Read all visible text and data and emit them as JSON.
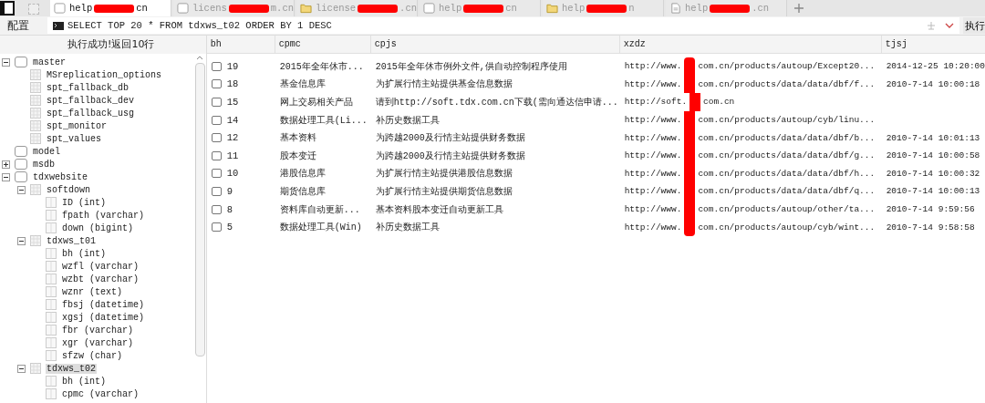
{
  "tabs": [
    {
      "kind": "page",
      "prefix": "help",
      "suffix": "cn",
      "selected": true
    },
    {
      "kind": "page",
      "prefix": "licens",
      "suffix": "m.cn",
      "selected": false
    },
    {
      "kind": "folder",
      "prefix": "license ",
      "suffix": ".cn",
      "selected": false
    },
    {
      "kind": "page",
      "prefix": "help",
      "suffix": "cn",
      "selected": false
    },
    {
      "kind": "folder",
      "prefix": "help",
      "suffix": "n",
      "selected": false
    },
    {
      "kind": "doc",
      "prefix": "help ",
      "suffix": ".cn",
      "selected": false
    }
  ],
  "query_bar": {
    "label": "配置",
    "query": "SELECT TOP 20 * FROM tdxws_t02 ORDER BY 1 DESC",
    "run_button": "执行"
  },
  "status": "执行成功!返回10行",
  "tree": [
    {
      "kind": "database",
      "label": "master",
      "expanded": true,
      "children": [
        {
          "kind": "table",
          "label": "MSreplication_options"
        },
        {
          "kind": "table",
          "label": "spt_fallback_db"
        },
        {
          "kind": "table",
          "label": "spt_fallback_dev"
        },
        {
          "kind": "table",
          "label": "spt_fallback_usg"
        },
        {
          "kind": "table",
          "label": "spt_monitor"
        },
        {
          "kind": "table",
          "label": "spt_values"
        }
      ]
    },
    {
      "kind": "database",
      "label": "model"
    },
    {
      "kind": "database",
      "label": "msdb",
      "expanded": false
    },
    {
      "kind": "database",
      "label": "tdxwebsite",
      "expanded": true,
      "children": [
        {
          "kind": "table",
          "label": "softdown",
          "expanded": true,
          "children": [
            {
              "kind": "column",
              "label": "ID (int)"
            },
            {
              "kind": "column",
              "label": "fpath (varchar)"
            },
            {
              "kind": "column",
              "label": "down (bigint)"
            }
          ]
        },
        {
          "kind": "table",
          "label": "tdxws_t01",
          "expanded": true,
          "children": [
            {
              "kind": "column",
              "label": "bh (int)"
            },
            {
              "kind": "column",
              "label": "wzfl (varchar)"
            },
            {
              "kind": "column",
              "label": "wzbt (varchar)"
            },
            {
              "kind": "column",
              "label": "wznr (text)"
            },
            {
              "kind": "column",
              "label": "fbsj (datetime)"
            },
            {
              "kind": "column",
              "label": "xgsj (datetime)"
            },
            {
              "kind": "column",
              "label": "fbr (varchar)"
            },
            {
              "kind": "column",
              "label": "xgr (varchar)"
            },
            {
              "kind": "column",
              "label": "sfzw (char)"
            }
          ]
        },
        {
          "kind": "table",
          "label": "tdxws_t02",
          "expanded": true,
          "selected": true,
          "children": [
            {
              "kind": "column",
              "label": "bh (int)"
            },
            {
              "kind": "column",
              "label": "cpmc (varchar)"
            }
          ]
        }
      ]
    }
  ],
  "table": {
    "columns": [
      "bh",
      "cpmc",
      "cpjs",
      "xzdz",
      "tjsj"
    ],
    "rows": [
      {
        "checked": false,
        "bh": "19",
        "cpmc": "2015年全年休市...",
        "cpjs": "2015年全年休市例外文件,供自动控制程序使用",
        "xzdz_start": "http://www.",
        "xzdz_end": "com.cn/products/autoup/Except20...",
        "tjsj": "2014-12-25 10:20:00"
      },
      {
        "checked": false,
        "bh": "18",
        "cpmc": "基金信息库",
        "cpjs": "为扩展行情主站提供基金信息数据",
        "xzdz_start": "http://www.",
        "xzdz_end": "com.cn/products/data/data/dbf/f...",
        "tjsj": "2010-7-14 10:00:18"
      },
      {
        "checked": false,
        "bh": "15",
        "cpmc": "网上交易相关产品",
        "cpjs": "请到http://soft.tdx.com.cn下载(需向通达信申请...",
        "xzdz_start": "http://soft.",
        "xzdz_end": "com.cn"
      },
      {
        "checked": false,
        "bh": "14",
        "cpmc": "数据处理工具(Li...",
        "cpjs": "补历史数据工具",
        "xzdz_start": "http://www.",
        "xzdz_end": "com.cn/products/autoup/cyb/linu..."
      },
      {
        "checked": false,
        "bh": "12",
        "cpmc": "基本资料",
        "cpjs": "为跨越2000及行情主站提供财务数据",
        "xzdz_start": "http://www.",
        "xzdz_end": "com.cn/products/data/data/dbf/b...",
        "tjsj": "2010-7-14 10:01:13"
      },
      {
        "checked": false,
        "bh": "11",
        "cpmc": "股本变迁",
        "cpjs": "为跨越2000及行情主站提供财务数据",
        "xzdz_start": "http://www.",
        "xzdz_end": "com.cn/products/data/data/dbf/g...",
        "tjsj": "2010-7-14 10:00:58"
      },
      {
        "checked": false,
        "bh": "10",
        "cpmc": "港股信息库",
        "cpjs": "为扩展行情主站提供港股信息数据",
        "xzdz_start": "http://www.",
        "xzdz_end": "com.cn/products/data/data/dbf/h...",
        "tjsj": "2010-7-14 10:00:32"
      },
      {
        "checked": false,
        "bh": "9",
        "cpmc": "期货信息库",
        "cpjs": "为扩展行情主站提供期货信息数据",
        "xzdz_start": "http://www.",
        "xzdz_end": "com.cn/products/data/data/dbf/q...",
        "tjsj": "2010-7-14 10:00:13"
      },
      {
        "checked": false,
        "bh": "8",
        "cpmc": "资料库自动更新...",
        "cpjs": "基本资料股本变迁自动更新工具",
        "xzdz_start": "http://www.",
        "xzdz_end": "com.cn/products/autoup/other/ta...",
        "tjsj": "2010-7-14 9:59:56"
      },
      {
        "checked": false,
        "bh": "5",
        "cpmc": "数据处理工具(Win)",
        "cpjs": "补历史数据工具",
        "xzdz_start": "http://www.",
        "xzdz_end": "com.cn/products/autoup/cyb/wint...",
        "tjsj": "2010-7-14 9:58:58"
      }
    ]
  }
}
